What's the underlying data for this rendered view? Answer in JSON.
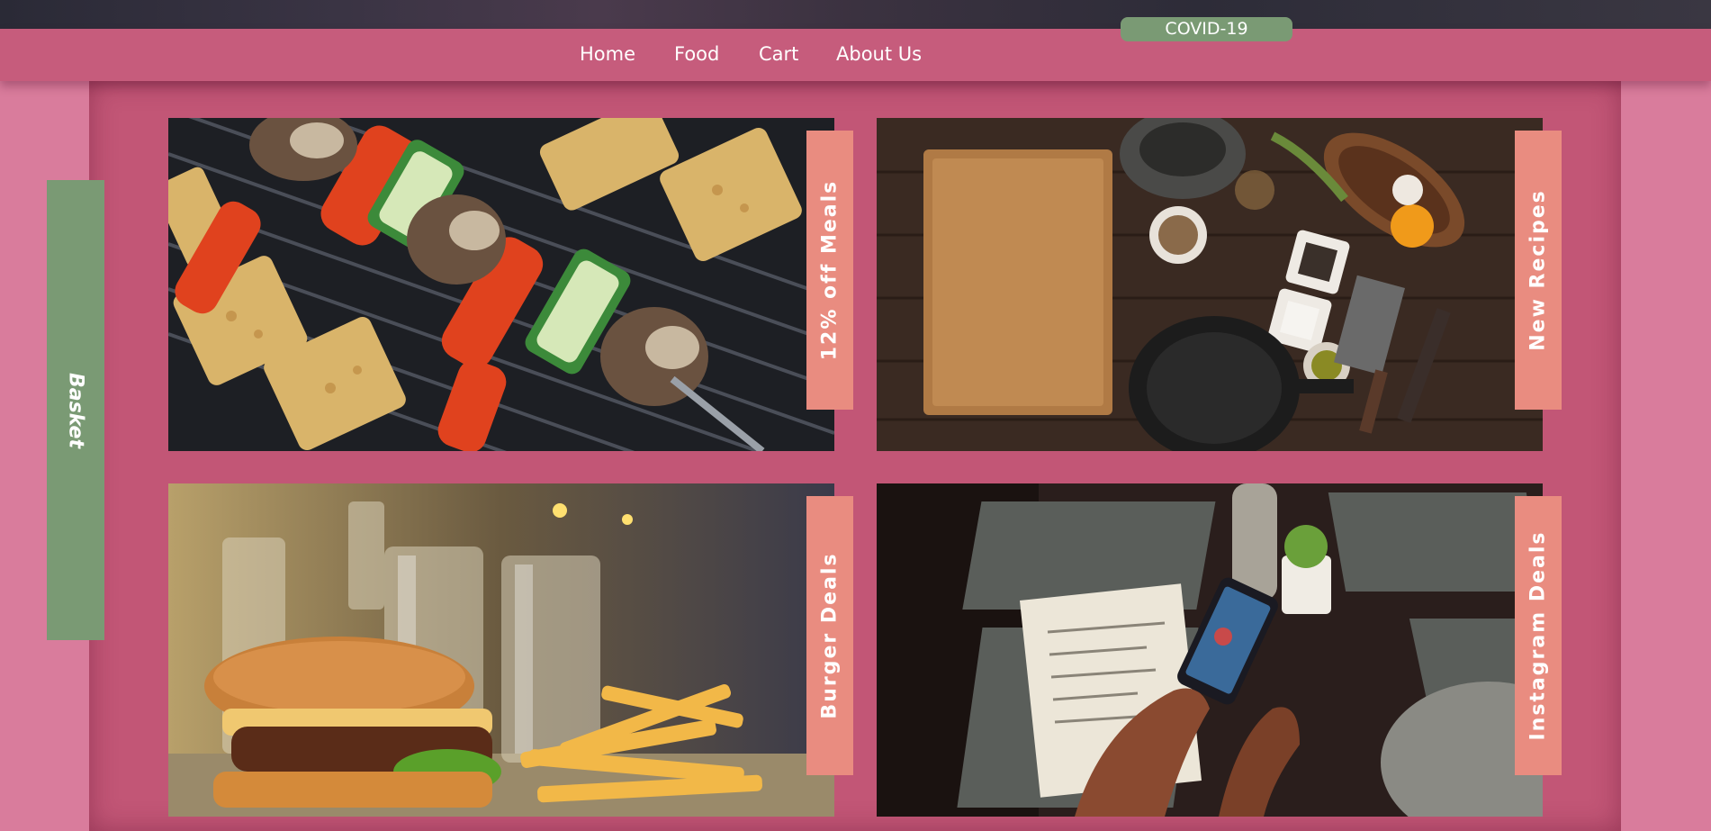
{
  "header": {
    "covid_badge": "COVID-19",
    "nav": [
      {
        "label": "Home"
      },
      {
        "label": "Food"
      },
      {
        "label": "Cart"
      },
      {
        "label": "About Us"
      }
    ]
  },
  "sidebar": {
    "basket_label": "Basket"
  },
  "promos": [
    {
      "label": "12% off Meals",
      "image": "grilled-skewers-photo"
    },
    {
      "label": "New Recipes",
      "image": "kitchen-table-photo"
    },
    {
      "label": "Burger Deals",
      "image": "burger-and-fries-photo"
    },
    {
      "label": "Instagram Deals",
      "image": "phone-at-restaurant-photo"
    }
  ],
  "colors": {
    "navbar": "#c65c7c",
    "main_panel": "#c25676",
    "side_panels": "#d97c9c",
    "accent_green": "#7a9a74",
    "tab_salmon": "#e98c80"
  }
}
